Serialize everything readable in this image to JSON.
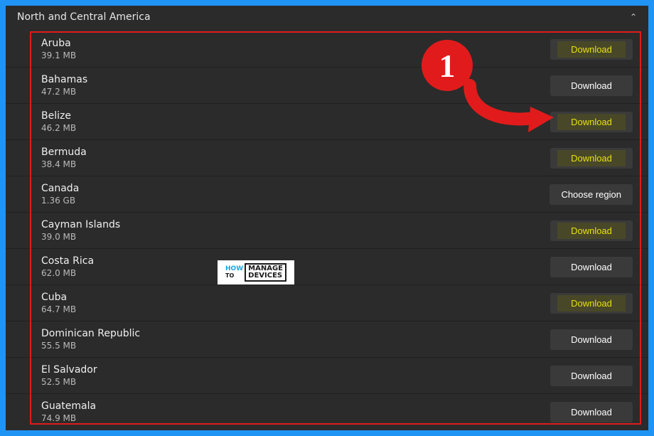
{
  "header": {
    "title": "North and Central America"
  },
  "annotation": {
    "badge": "1"
  },
  "watermark": {
    "how": "HOW",
    "to": "TO",
    "line1": "MANAGE",
    "line2": "DEVICES"
  },
  "items": [
    {
      "name": "Aruba",
      "size": "39.1 MB",
      "button": "Download",
      "highlight": true
    },
    {
      "name": "Bahamas",
      "size": "47.2 MB",
      "button": "Download",
      "highlight": false
    },
    {
      "name": "Belize",
      "size": "46.2 MB",
      "button": "Download",
      "highlight": true
    },
    {
      "name": "Bermuda",
      "size": "38.4 MB",
      "button": "Download",
      "highlight": true
    },
    {
      "name": "Canada",
      "size": "1.36 GB",
      "button": "Choose region",
      "highlight": false
    },
    {
      "name": "Cayman Islands",
      "size": "39.0 MB",
      "button": "Download",
      "highlight": true
    },
    {
      "name": "Costa Rica",
      "size": "62.0 MB",
      "button": "Download",
      "highlight": false
    },
    {
      "name": "Cuba",
      "size": "64.7 MB",
      "button": "Download",
      "highlight": true
    },
    {
      "name": "Dominican Republic",
      "size": "55.5 MB",
      "button": "Download",
      "highlight": false
    },
    {
      "name": "El Salvador",
      "size": "52.5 MB",
      "button": "Download",
      "highlight": false
    },
    {
      "name": "Guatemala",
      "size": "74.9 MB",
      "button": "Download",
      "highlight": false
    }
  ]
}
